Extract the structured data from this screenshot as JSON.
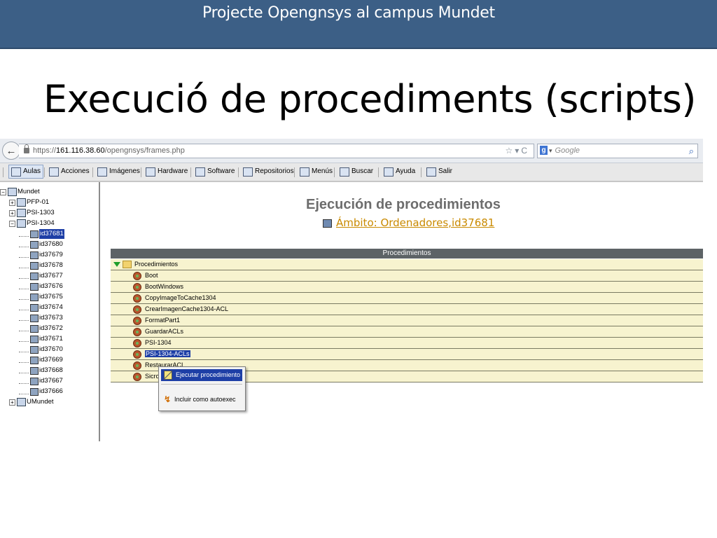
{
  "slide": {
    "banner": "Projecte Opengnsys al campus Mundet",
    "title": "Execució de procediments (scripts)"
  },
  "browser": {
    "url_prefix": "https://",
    "url_host": "161.116.38.60",
    "url_path": "/opengnsys/frames.php",
    "search_placeholder": "Google"
  },
  "menu": {
    "items": [
      {
        "label": "Aulas",
        "icon": "classrooms-icon"
      },
      {
        "label": "Acciones",
        "icon": "actions-icon"
      },
      {
        "label": "Imágenes",
        "icon": "images-icon"
      },
      {
        "label": "Hardware",
        "icon": "hardware-icon"
      },
      {
        "label": "Software",
        "icon": "software-icon"
      },
      {
        "label": "Repositorios",
        "icon": "repositories-icon"
      },
      {
        "label": "Menús",
        "icon": "menus-icon"
      },
      {
        "label": "Buscar",
        "icon": "search-icon"
      },
      {
        "label": "Ayuda",
        "icon": "help-icon"
      },
      {
        "label": "Salir",
        "icon": "exit-icon"
      }
    ]
  },
  "tree": {
    "root": "Mundet",
    "groups": [
      "PFP-01",
      "PSI-1303",
      "PSI-1304"
    ],
    "computers": [
      "id37681",
      "id37680",
      "id37679",
      "id37678",
      "id37677",
      "id37676",
      "id37675",
      "id37674",
      "id37673",
      "id37672",
      "id37671",
      "id37670",
      "id37669",
      "id37668",
      "id37667",
      "id37666"
    ],
    "last_group": "UMundet"
  },
  "main": {
    "title": "Ejecución de procedimientos",
    "scope": "Ámbito: Ordenadores,id37681",
    "table_header": "Procedimientos",
    "folder": "Procedimientos",
    "procedures": [
      "Boot",
      "BootWindows",
      "CopyImageToCache1304",
      "CrearImagenCache1304-ACL",
      "FormatPart1",
      "GuardarACLs",
      "PSI-1304",
      "PSI-1304-ACLs",
      "RestaurarACL",
      "Sicro"
    ]
  },
  "context_menu": {
    "items": [
      "Ejecutar procedimiento",
      "Incluir como autoexec"
    ]
  }
}
